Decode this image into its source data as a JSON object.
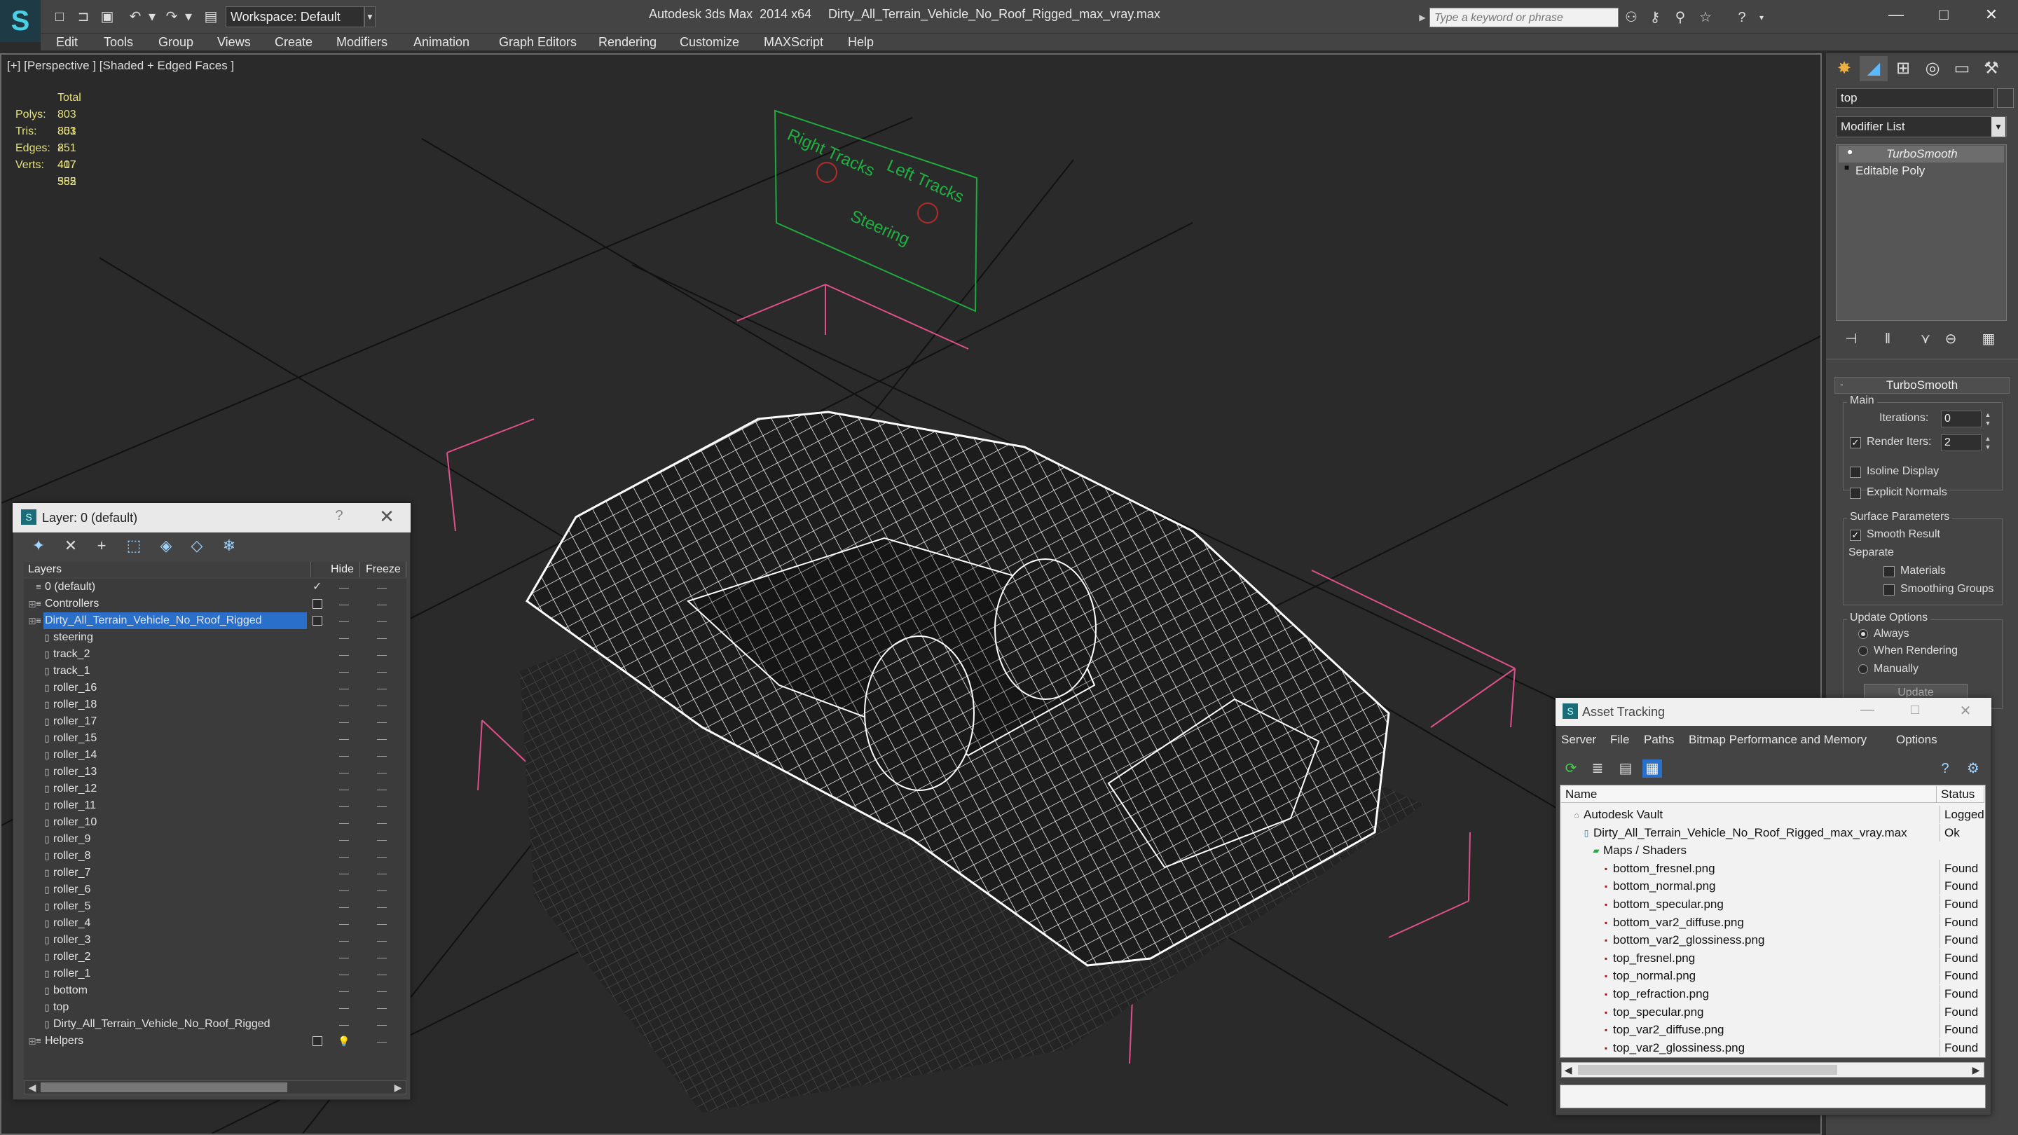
{
  "titlebar": {
    "workspace": "Workspace: Default",
    "app_title": "Autodesk 3ds Max  2014 x64",
    "file_title": "Dirty_All_Terrain_Vehicle_No_Roof_Rigged_max_vray.max",
    "search_placeholder": "Type a keyword or phrase"
  },
  "menu": [
    "Edit",
    "Tools",
    "Group",
    "Views",
    "Create",
    "Modifiers",
    "Animation",
    "Graph Editors",
    "Rendering",
    "Customize",
    "MAXScript",
    "Help"
  ],
  "viewport": {
    "label": "[+] [Perspective ] [Shaded + Edged Faces ]",
    "stats_header": "Total",
    "stats": [
      {
        "label": "Polys:",
        "value": "803 851"
      },
      {
        "label": "Tris:",
        "value": "803 851"
      },
      {
        "label": "Edges:",
        "value": "2 407 552"
      },
      {
        "label": "Verts:",
        "value": "417 385"
      }
    ],
    "sign_texts": [
      "Right Tracks",
      "Left Tracks",
      "Steering"
    ]
  },
  "command_panel": {
    "object_name": "top",
    "modifier_list": "Modifier List",
    "stack": [
      "TurboSmooth",
      "Editable Poly"
    ],
    "rollout_title": "TurboSmooth",
    "main_group": "Main",
    "iterations_label": "Iterations:",
    "iterations_value": "0",
    "render_iters_label": "Render Iters:",
    "render_iters_value": "2",
    "isoline_label": "Isoline Display",
    "explicit_normals_label": "Explicit Normals",
    "surface_group": "Surface Parameters",
    "smooth_result_label": "Smooth Result",
    "separate_label": "Separate",
    "materials_label": "Materials",
    "smoothing_groups_label": "Smoothing Groups",
    "update_group": "Update Options",
    "always_label": "Always",
    "when_rendering_label": "When Rendering",
    "manually_label": "Manually",
    "update_button": "Update"
  },
  "layer_window": {
    "title": "Layer: 0 (default)",
    "help": "?",
    "col_layers": "Layers",
    "col_hide": "Hide",
    "col_freeze": "Freeze",
    "rows": [
      {
        "name": "0 (default)",
        "level": 0,
        "kind": "layer",
        "current": true
      },
      {
        "name": "Controllers",
        "level": 0,
        "kind": "layer",
        "expandable": true
      },
      {
        "name": "Dirty_All_Terrain_Vehicle_No_Roof_Rigged",
        "level": 0,
        "kind": "layer",
        "expandable": true,
        "selected": true
      },
      {
        "name": "steering",
        "level": 1,
        "kind": "object"
      },
      {
        "name": "track_2",
        "level": 1,
        "kind": "object"
      },
      {
        "name": "track_1",
        "level": 1,
        "kind": "object"
      },
      {
        "name": "roller_16",
        "level": 1,
        "kind": "object"
      },
      {
        "name": "roller_18",
        "level": 1,
        "kind": "object"
      },
      {
        "name": "roller_17",
        "level": 1,
        "kind": "object"
      },
      {
        "name": "roller_15",
        "level": 1,
        "kind": "object"
      },
      {
        "name": "roller_14",
        "level": 1,
        "kind": "object"
      },
      {
        "name": "roller_13",
        "level": 1,
        "kind": "object"
      },
      {
        "name": "roller_12",
        "level": 1,
        "kind": "object"
      },
      {
        "name": "roller_11",
        "level": 1,
        "kind": "object"
      },
      {
        "name": "roller_10",
        "level": 1,
        "kind": "object"
      },
      {
        "name": "roller_9",
        "level": 1,
        "kind": "object"
      },
      {
        "name": "roller_8",
        "level": 1,
        "kind": "object"
      },
      {
        "name": "roller_7",
        "level": 1,
        "kind": "object"
      },
      {
        "name": "roller_6",
        "level": 1,
        "kind": "object"
      },
      {
        "name": "roller_5",
        "level": 1,
        "kind": "object"
      },
      {
        "name": "roller_4",
        "level": 1,
        "kind": "object"
      },
      {
        "name": "roller_3",
        "level": 1,
        "kind": "object"
      },
      {
        "name": "roller_2",
        "level": 1,
        "kind": "object"
      },
      {
        "name": "roller_1",
        "level": 1,
        "kind": "object"
      },
      {
        "name": "bottom",
        "level": 1,
        "kind": "object"
      },
      {
        "name": "top",
        "level": 1,
        "kind": "object"
      },
      {
        "name": "Dirty_All_Terrain_Vehicle_No_Roof_Rigged",
        "level": 1,
        "kind": "object"
      },
      {
        "name": "Helpers",
        "level": 0,
        "kind": "layer",
        "expandable": true,
        "bulb": true
      }
    ]
  },
  "asset_window": {
    "title": "Asset Tracking",
    "menu": [
      "Server",
      "File",
      "Paths",
      "Bitmap Performance and Memory",
      "Options"
    ],
    "col_name": "Name",
    "col_status": "Status",
    "rows": [
      {
        "name": "Autodesk Vault",
        "status": "Logged",
        "level": 0,
        "kind": "vault"
      },
      {
        "name": "Dirty_All_Terrain_Vehicle_No_Roof_Rigged_max_vray.max",
        "status": "Ok",
        "level": 1,
        "kind": "file"
      },
      {
        "name": "Maps / Shaders",
        "status": "",
        "level": 2,
        "kind": "folder"
      },
      {
        "name": "bottom_fresnel.png",
        "status": "Found",
        "level": 3,
        "kind": "png"
      },
      {
        "name": "bottom_normal.png",
        "status": "Found",
        "level": 3,
        "kind": "png"
      },
      {
        "name": "bottom_specular.png",
        "status": "Found",
        "level": 3,
        "kind": "png"
      },
      {
        "name": "bottom_var2_diffuse.png",
        "status": "Found",
        "level": 3,
        "kind": "png"
      },
      {
        "name": "bottom_var2_glossiness.png",
        "status": "Found",
        "level": 3,
        "kind": "png"
      },
      {
        "name": "top_fresnel.png",
        "status": "Found",
        "level": 3,
        "kind": "png"
      },
      {
        "name": "top_normal.png",
        "status": "Found",
        "level": 3,
        "kind": "png"
      },
      {
        "name": "top_refraction.png",
        "status": "Found",
        "level": 3,
        "kind": "png"
      },
      {
        "name": "top_specular.png",
        "status": "Found",
        "level": 3,
        "kind": "png"
      },
      {
        "name": "top_var2_diffuse.png",
        "status": "Found",
        "level": 3,
        "kind": "png"
      },
      {
        "name": "top_var2_glossiness.png",
        "status": "Found",
        "level": 3,
        "kind": "png"
      }
    ]
  },
  "colors": {
    "selection": "#2a6fc9",
    "stats_text": "#e6e07a",
    "wireframe": "#ffffff",
    "gizmo": "#e0508a",
    "grid_sign": "#1faa3c"
  }
}
